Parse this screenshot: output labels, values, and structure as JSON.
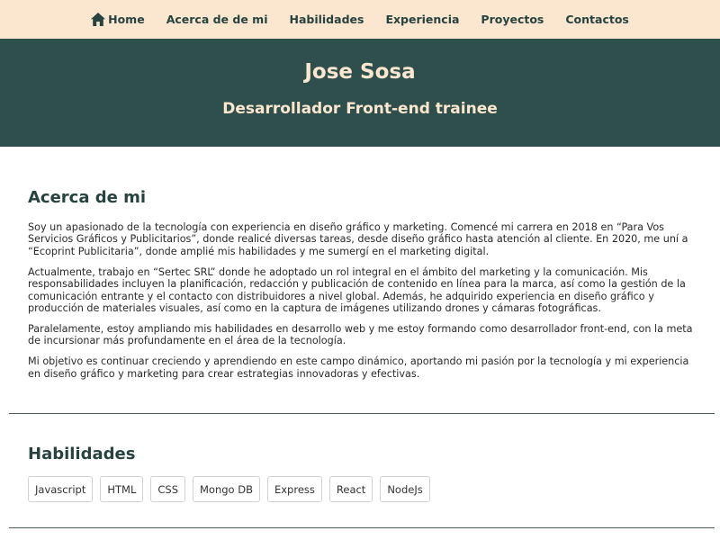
{
  "nav": {
    "items": [
      {
        "label": "Home",
        "icon": "home-icon"
      },
      {
        "label": "Acerca de de mi"
      },
      {
        "label": "Habilidades"
      },
      {
        "label": "Experiencia"
      },
      {
        "label": "Proyectos"
      },
      {
        "label": "Contactos"
      }
    ]
  },
  "hero": {
    "name": "Jose Sosa",
    "role": "Desarrollador Front-end trainee"
  },
  "about": {
    "title": "Acerca de mi",
    "paragraphs": [
      "Soy un apasionado de la tecnología con experiencia en diseño gráfico y marketing. Comencé mi carrera en 2018 en “Para Vos Servicios Gráficos y Publicitarios”, donde realicé diversas tareas, desde diseño gráfico hasta atención al cliente. En 2020, me uní a “Ecoprint Publicitaria”, donde amplié mis habilidades y me sumergí en el marketing digital.",
      "Actualmente, trabajo en “Sertec SRL” donde he adoptado un rol integral en el ámbito del marketing y la comunicación. Mis responsabilidades incluyen la planificación, redacción y publicación de contenido en línea para la marca, así como la gestión de la comunicación entrante y el contacto con distribuidores a nivel global. Además, he adquirido experiencia en diseño gráfico y producción de materiales visuales, así como en la captura de imágenes utilizando drones y cámaras fotográficas.",
      "Paralelamente, estoy ampliando mis habilidades en desarrollo web y me estoy formando como desarrollador front-end, con la meta de incursionar más profundamente en el área de la tecnología.",
      "Mi objetivo es continuar creciendo y aprendiendo en este campo dinámico, aportando mi pasión por la tecnología y mi experiencia en diseño gráfico y marketing para crear estrategias innovadoras y efectivas."
    ]
  },
  "skills": {
    "title": "Habilidades",
    "items": [
      "Javascript",
      "HTML",
      "CSS",
      "Mongo DB",
      "Express",
      "React",
      "NodeJs"
    ]
  },
  "colors": {
    "nav_bg": "#fbe7cf",
    "hero_bg": "#2f4f4c",
    "accent_text": "#27433f"
  }
}
